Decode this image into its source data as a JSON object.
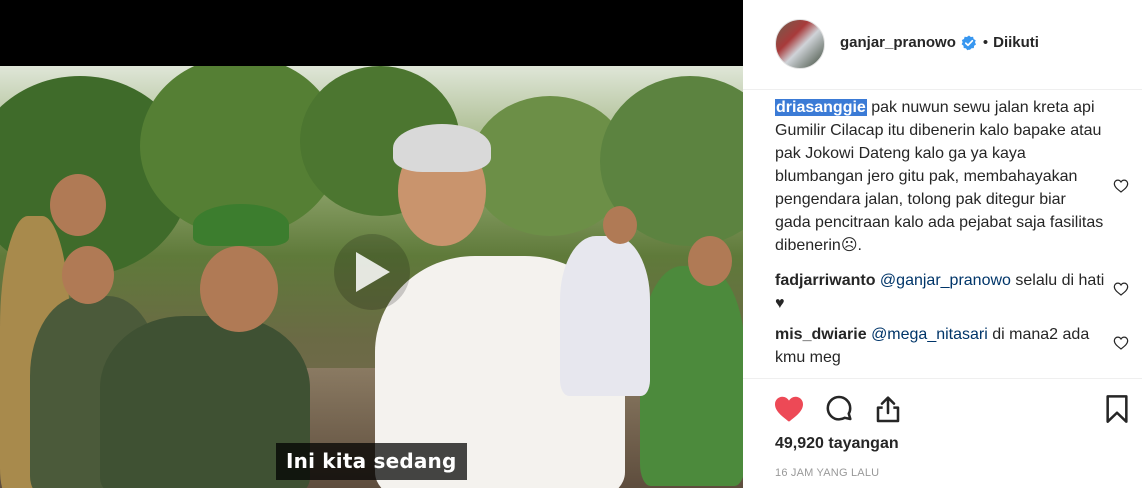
{
  "post": {
    "username": "ganjar_pranowo",
    "verified": true,
    "separator": "•",
    "follow_status": "Diikuti"
  },
  "video": {
    "caption": "Ini kita sedang",
    "play_icon": "play-icon"
  },
  "comments": [
    {
      "handle": "driasanggie",
      "text": " pak nuwun sewu jalan kreta api Gumilir Cilacap itu dibenerin kalo bapake atau pak Jokowi Dateng kalo ga ya kaya blumbangan jero gitu pak, membahayakan pengendara jalan, tolong pak ditegur biar gada pencitraan kalo ada pejabat saja fasilitas dibenerin☹."
    },
    {
      "handle": "fadjarriwanto",
      "mention": "@ganjar_pranowo",
      "text": " selalu di hati ♥"
    },
    {
      "handle": "mis_dwiarie",
      "mention": "@mega_nitasari",
      "text": " di mana2 ada kmu meg"
    }
  ],
  "actions": {
    "like_icon": "heart-filled-icon",
    "comment_icon": "comment-bubble-icon",
    "share_icon": "share-icon",
    "save_icon": "bookmark-icon",
    "like_color": "#ed4956"
  },
  "stats": {
    "views": "49,920 tayangan",
    "timestamp": "16 JAM YANG LALU"
  }
}
